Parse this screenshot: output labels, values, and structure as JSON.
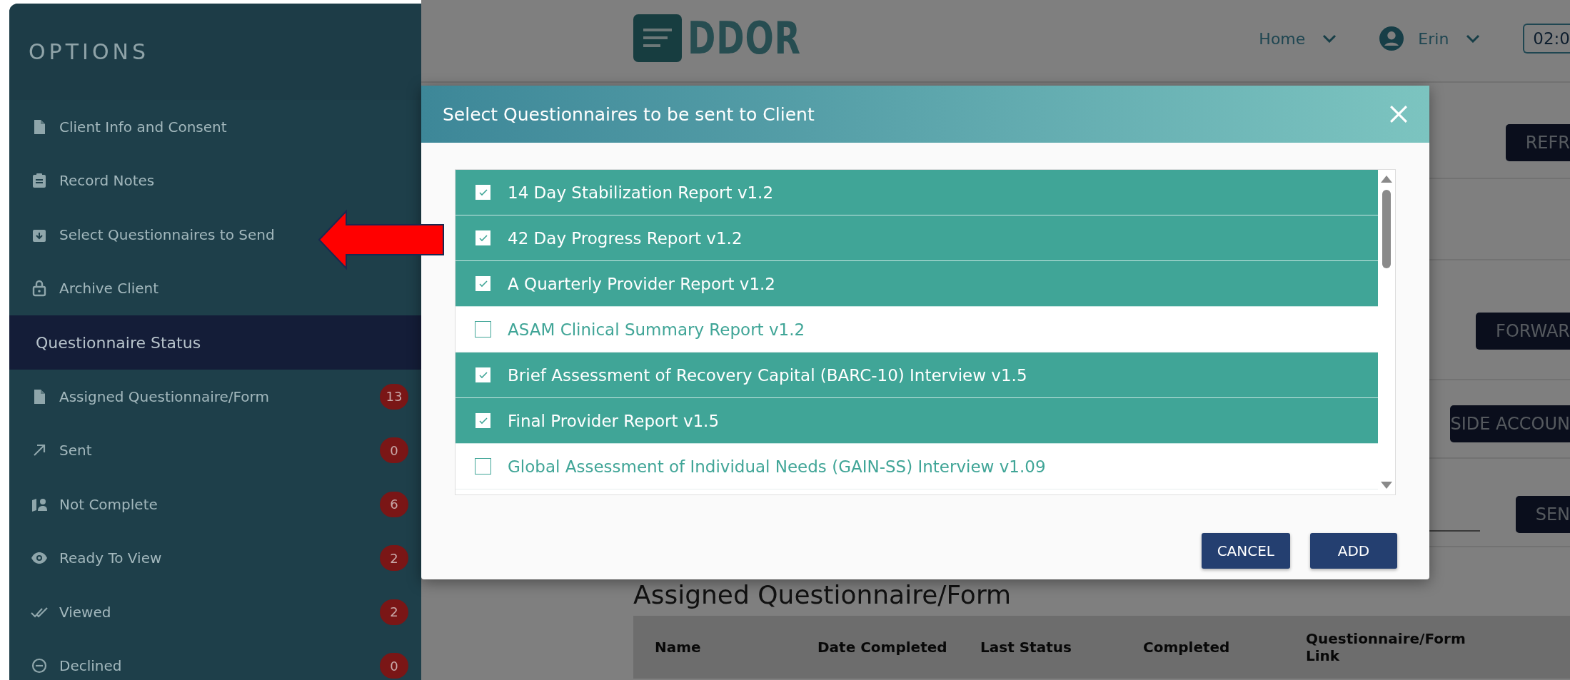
{
  "sidebar": {
    "title": "OPTIONS",
    "items": [
      {
        "label": "Client Info and Consent"
      },
      {
        "label": "Record Notes"
      },
      {
        "label": "Select Questionnaires to Send"
      },
      {
        "label": "Archive Client"
      }
    ],
    "section": "Questionnaire Status",
    "status_items": [
      {
        "label": "Assigned Questionnaire/Form",
        "count": "13"
      },
      {
        "label": "Sent",
        "count": "0"
      },
      {
        "label": "Not Complete",
        "count": "6"
      },
      {
        "label": "Ready To View",
        "count": "2"
      },
      {
        "label": "Viewed",
        "count": "2"
      },
      {
        "label": "Declined",
        "count": "0"
      }
    ]
  },
  "header": {
    "logo": "DDOR",
    "nav": [
      {
        "label": "Home",
        "kind": "menu"
      },
      {
        "label": "Erin",
        "kind": "user"
      }
    ],
    "time": "02:0"
  },
  "page": {
    "buttons": [
      "REFR",
      "FORWAR",
      "SIDE ACCOUN",
      "SEN"
    ],
    "heading": "Assigned Questionnaire/Form",
    "table": {
      "columns": [
        "Name",
        "Date Completed",
        "Last Status",
        "Completed",
        "Questionnaire/Form Link"
      ]
    }
  },
  "modal": {
    "title": "Select Questionnaires to be sent to Client",
    "items": [
      {
        "label": "14 Day Stabilization Report v1.2",
        "checked": true
      },
      {
        "label": "42 Day Progress Report v1.2",
        "checked": true
      },
      {
        "label": "A Quarterly Provider Report v1.2",
        "checked": true
      },
      {
        "label": "ASAM Clinical Summary Report v1.2",
        "checked": false
      },
      {
        "label": "Brief Assessment of Recovery Capital (BARC-10) Interview v1.5",
        "checked": true
      },
      {
        "label": "Final Provider Report v1.5",
        "checked": true
      },
      {
        "label": "Global Assessment of Individual Needs (GAIN-SS) Interview v1.09",
        "checked": false
      }
    ],
    "buttons": [
      "CANCEL",
      "ADD"
    ]
  }
}
